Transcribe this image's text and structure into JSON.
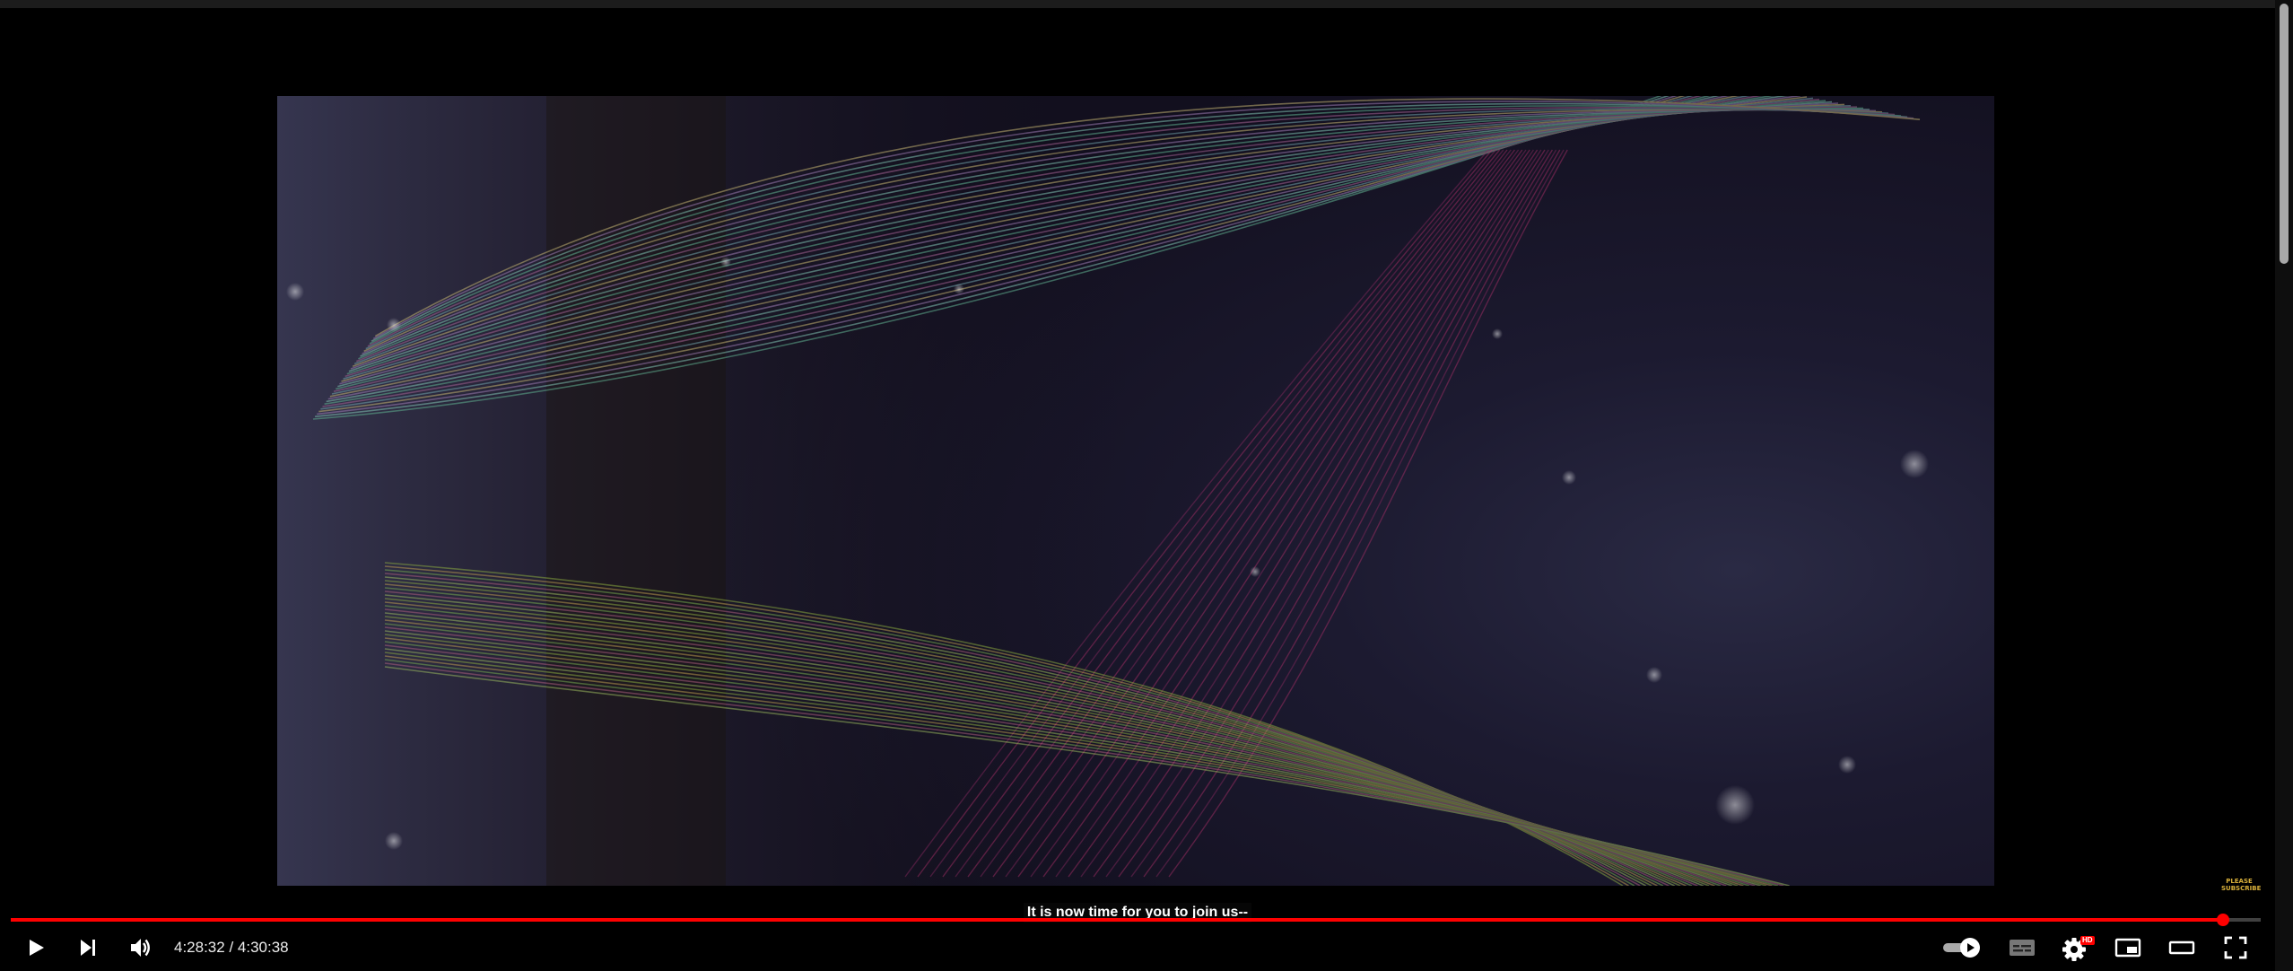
{
  "player": {
    "caption": "It is now time for you to join us--",
    "time_current": "4:28:32",
    "time_separator": " / ",
    "time_total": "4:30:38",
    "progress_fraction": 0.9833,
    "watermark_line1": "PLEASE",
    "watermark_line2": "SUBSCRIBE",
    "hd_badge": "HD",
    "colors": {
      "progress": "#ff0000",
      "controls": "#ffffff",
      "background": "#000000"
    },
    "icons": {
      "play": "play-icon",
      "next": "next-icon",
      "volume": "volume-icon",
      "autoplay": "autoplay-toggle-icon",
      "subtitles": "subtitles-icon",
      "settings": "gear-icon",
      "miniplayer": "miniplayer-icon",
      "theater": "theater-mode-icon",
      "fullscreen": "fullscreen-icon"
    }
  }
}
